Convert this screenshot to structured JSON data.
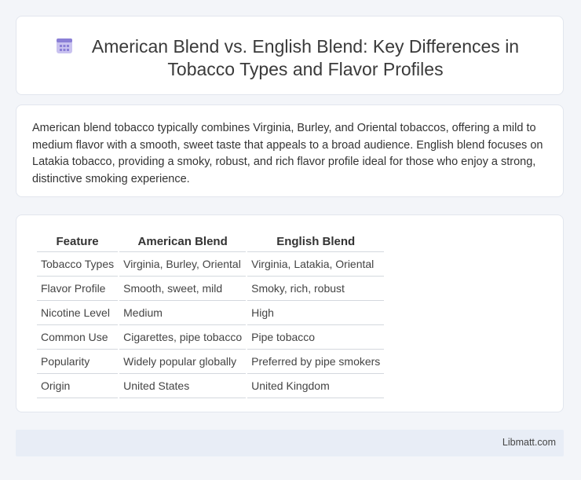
{
  "header": {
    "title": "American Blend vs. English Blend: Key Differences in Tobacco Types and Flavor Profiles",
    "icon": "calendar-grid-icon",
    "icon_color": "#8b7fd6"
  },
  "summary": {
    "text": "American blend tobacco typically combines Virginia, Burley, and Oriental tobaccos, offering a mild to medium flavor with a smooth, sweet taste that appeals to a broad audience. English blend focuses on Latakia tobacco, providing a smoky, robust, and rich flavor profile ideal for those who enjoy a strong, distinctive smoking experience."
  },
  "table": {
    "headers": [
      "Feature",
      "American Blend",
      "English Blend"
    ],
    "rows": [
      [
        "Tobacco Types",
        "Virginia, Burley, Oriental",
        "Virginia, Latakia, Oriental"
      ],
      [
        "Flavor Profile",
        "Smooth, sweet, mild",
        "Smoky, rich, robust"
      ],
      [
        "Nicotine Level",
        "Medium",
        "High"
      ],
      [
        "Common Use",
        "Cigarettes, pipe tobacco",
        "Pipe tobacco"
      ],
      [
        "Popularity",
        "Widely popular globally",
        "Preferred by pipe smokers"
      ],
      [
        "Origin",
        "United States",
        "United Kingdom"
      ]
    ]
  },
  "footer": {
    "link": "Libmatt.com"
  }
}
